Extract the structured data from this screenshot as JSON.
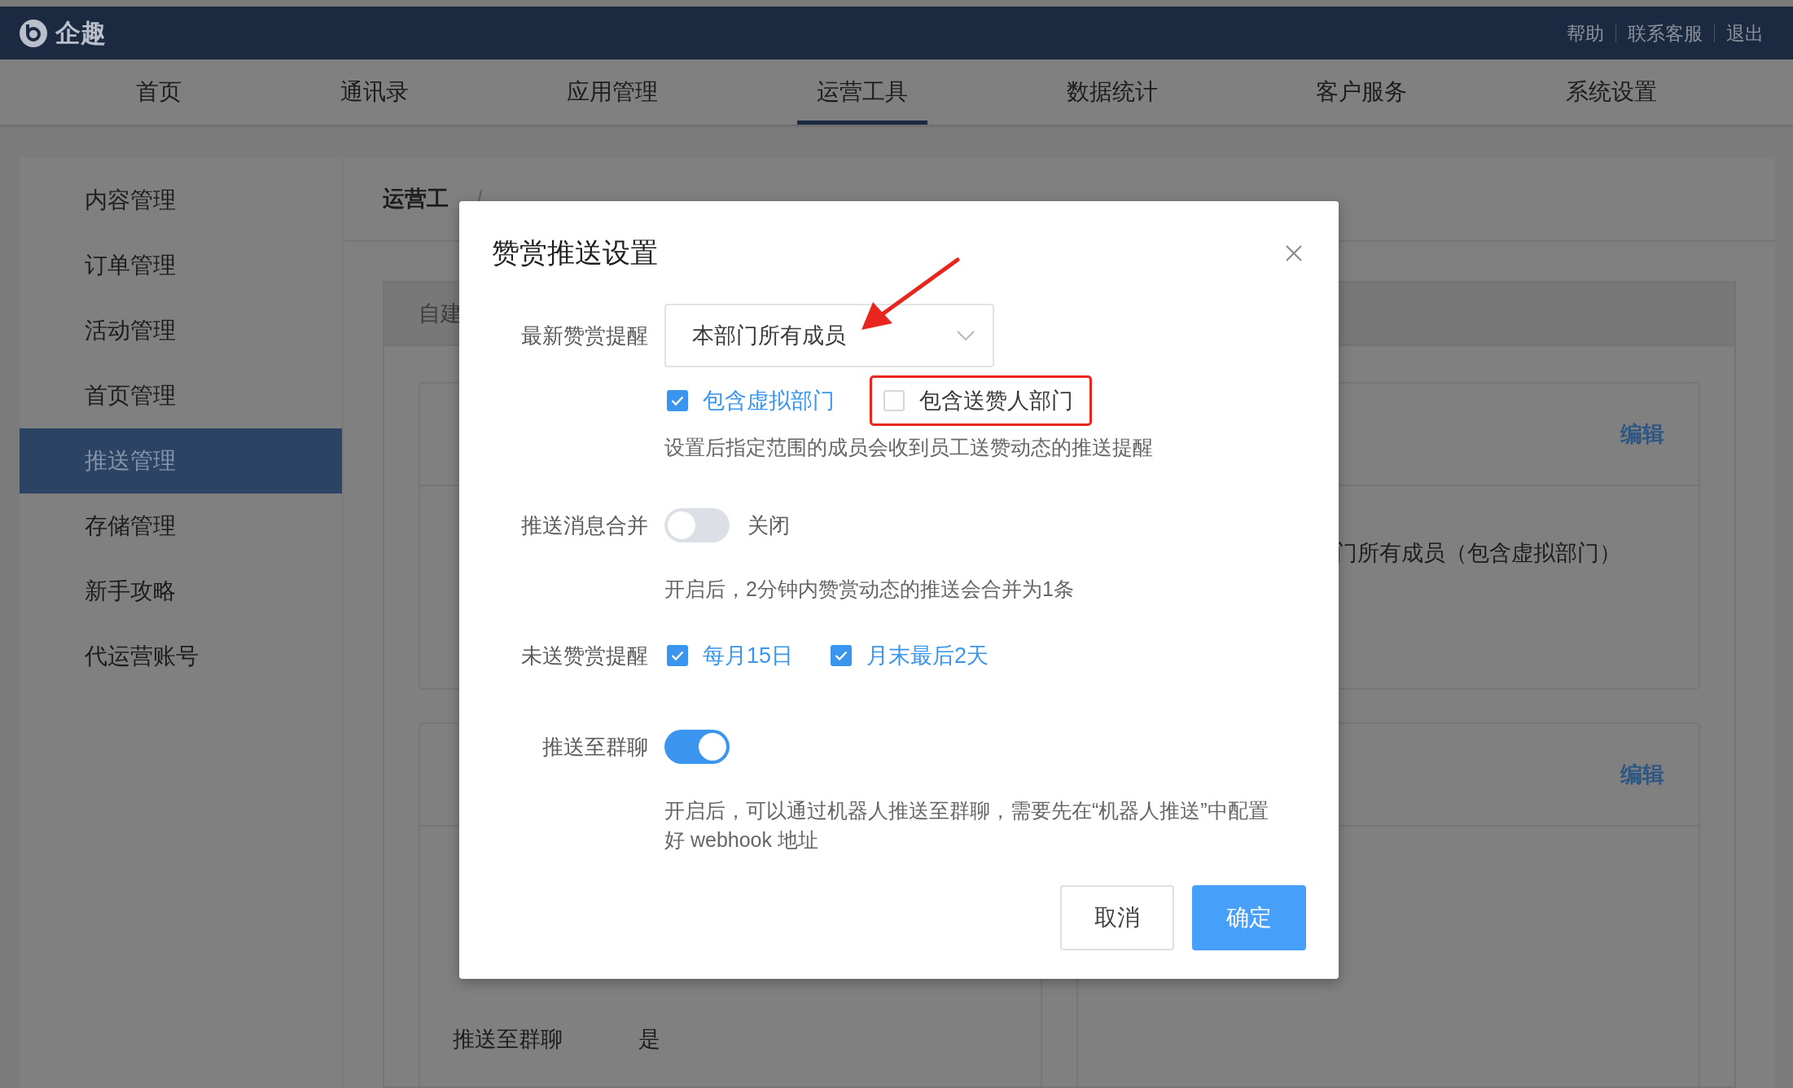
{
  "header": {
    "logo": "企趣",
    "links": [
      "帮助",
      "联系客服",
      "退出"
    ]
  },
  "nav": [
    {
      "label": "首页",
      "selected": false
    },
    {
      "label": "通讯录",
      "selected": false
    },
    {
      "label": "应用管理",
      "selected": false
    },
    {
      "label": "运营工具",
      "selected": true
    },
    {
      "label": "数据统计",
      "selected": false
    },
    {
      "label": "客户服务",
      "selected": false
    },
    {
      "label": "系统设置",
      "selected": false
    }
  ],
  "sidebar": [
    {
      "label": "内容管理",
      "selected": false
    },
    {
      "label": "订单管理",
      "selected": false
    },
    {
      "label": "活动管理",
      "selected": false
    },
    {
      "label": "首页管理",
      "selected": false
    },
    {
      "label": "推送管理",
      "selected": true
    },
    {
      "label": "存储管理",
      "selected": false
    },
    {
      "label": "新手攻略",
      "selected": false
    },
    {
      "label": "代运营账号",
      "selected": false
    }
  ],
  "breadcrumb": {
    "items": [
      "运营工"
    ],
    "separator": "/"
  },
  "section_tab": "自建",
  "cards": [
    {
      "action": "编辑",
      "rows": [
        {
          "value": "门所有成员（包含虚拟部门）"
        }
      ]
    },
    {
      "rows": [
        {
          "label": "推送至群聊",
          "value": "是"
        }
      ]
    },
    {
      "action": "编辑"
    }
  ],
  "dialog": {
    "title": "赞赏推送设置",
    "fields": [
      {
        "kind": "select",
        "label": "最新赞赏提醒",
        "value": "本部门所有成员",
        "options": [
          {
            "label": "包含虚拟部门",
            "checked": true,
            "annotated": false
          },
          {
            "label": "包含送赞人部门",
            "checked": false,
            "annotated": true
          }
        ],
        "help": "设置后指定范围的成员会收到员工送赞动态的推送提醒",
        "arrow": true
      },
      {
        "kind": "switch",
        "label": "推送消息合并",
        "on": false,
        "state_text": "关闭",
        "help": "开启后，2分钟内赞赏动态的推送会合并为1条"
      },
      {
        "kind": "checks",
        "label": "未送赞赏提醒",
        "options": [
          {
            "label": "每月15日",
            "checked": true,
            "annotated": false
          },
          {
            "label": "月末最后2天",
            "checked": true,
            "annotated": false
          }
        ]
      },
      {
        "kind": "switch",
        "label": "推送至群聊",
        "on": true,
        "help": "开启后，可以通过机器人推送至群聊，需要先在“机器人推送”中配置好 webhook 地址"
      }
    ],
    "buttons": [
      {
        "label": "取消",
        "kind": "secondary"
      },
      {
        "label": "确定",
        "kind": "primary"
      }
    ]
  }
}
